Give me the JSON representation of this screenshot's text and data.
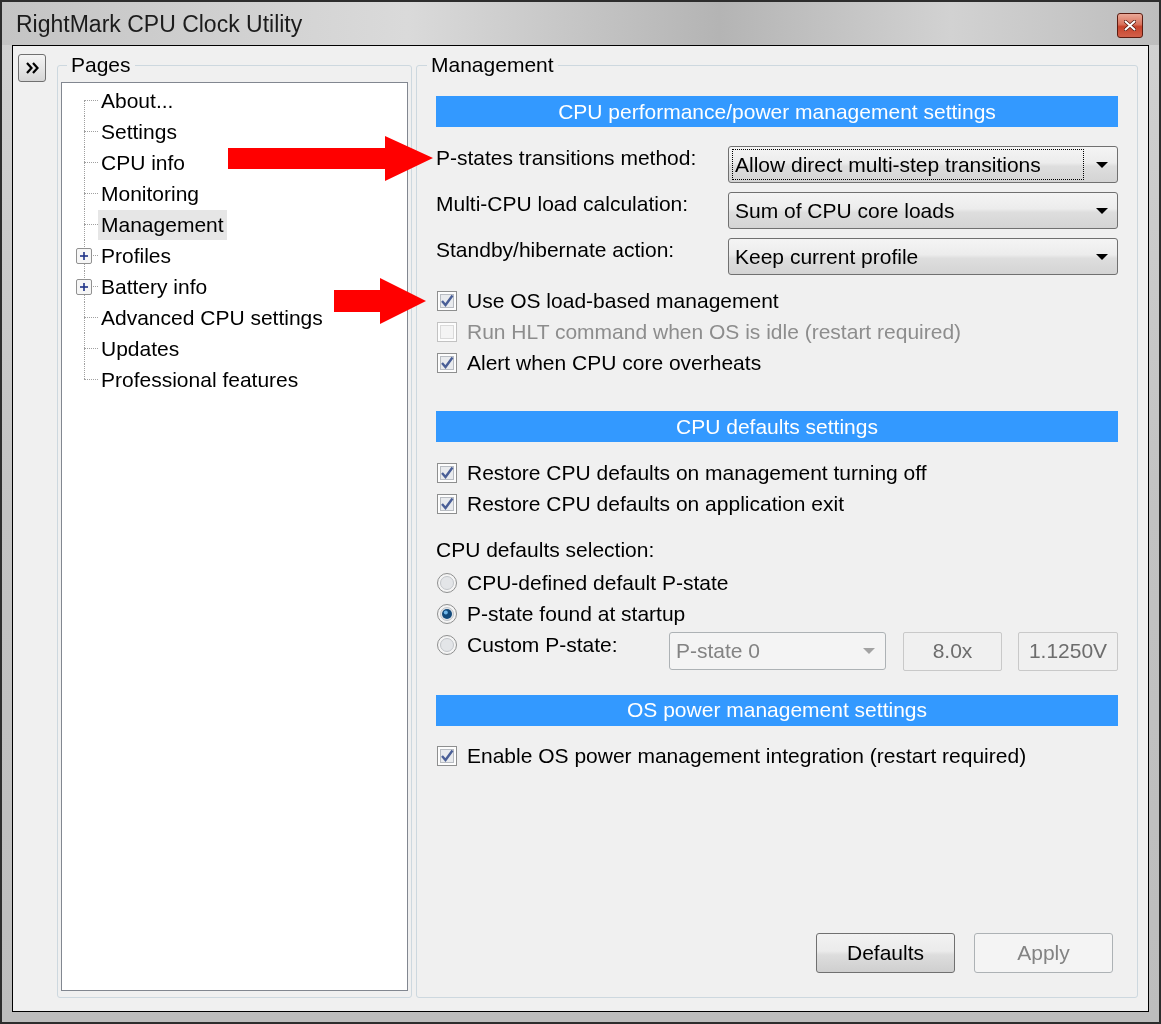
{
  "window": {
    "title": "RightMark CPU Clock Utility"
  },
  "pages": {
    "title": "Pages",
    "items": [
      {
        "label": "About...",
        "kind": "leaf",
        "selected": false
      },
      {
        "label": "Settings",
        "kind": "leaf",
        "selected": false
      },
      {
        "label": "CPU info",
        "kind": "leaf",
        "selected": false
      },
      {
        "label": "Monitoring",
        "kind": "leaf",
        "selected": false
      },
      {
        "label": "Management",
        "kind": "leaf",
        "selected": true
      },
      {
        "label": "Profiles",
        "kind": "group",
        "expanded": false,
        "selected": false
      },
      {
        "label": "Battery info",
        "kind": "group",
        "expanded": false,
        "selected": false
      },
      {
        "label": "Advanced CPU settings",
        "kind": "leaf",
        "selected": false
      },
      {
        "label": "Updates",
        "kind": "leaf",
        "selected": false
      },
      {
        "label": "Professional features",
        "kind": "leaf",
        "selected": false
      }
    ]
  },
  "management": {
    "title": "Management",
    "sections": [
      {
        "header": "CPU performance/power management settings",
        "controls": [
          {
            "kind": "dropdown",
            "label": "P-states transitions method:",
            "value": "Allow direct multi-step transitions",
            "focused": true
          },
          {
            "kind": "dropdown",
            "label": "Multi-CPU load calculation:",
            "value": "Sum of CPU core loads",
            "focused": false
          },
          {
            "kind": "dropdown",
            "label": "Standby/hibernate action:",
            "value": "Keep current profile",
            "focused": false
          },
          {
            "kind": "checkbox",
            "label": "Use OS load-based management",
            "checked": true,
            "disabled": false
          },
          {
            "kind": "checkbox",
            "label": "Run HLT command when OS is idle (restart required)",
            "checked": false,
            "disabled": true
          },
          {
            "kind": "checkbox",
            "label": "Alert when CPU core overheats",
            "checked": true,
            "disabled": false
          }
        ]
      },
      {
        "header": "CPU defaults settings",
        "controls": [
          {
            "kind": "checkbox",
            "label": "Restore CPU defaults on management turning off",
            "checked": true,
            "disabled": false
          },
          {
            "kind": "checkbox",
            "label": "Restore CPU defaults on application exit",
            "checked": true,
            "disabled": false
          },
          {
            "kind": "caption",
            "label": "CPU defaults selection:"
          },
          {
            "kind": "radio",
            "label": "CPU-defined default P-state",
            "selected": false
          },
          {
            "kind": "radio",
            "label": "P-state found at startup",
            "selected": true
          },
          {
            "kind": "radio",
            "label": "Custom P-state:",
            "selected": false,
            "pstate": {
              "value": "P-state 0",
              "disabled": true
            },
            "multiplier": {
              "value": "8.0x",
              "disabled": true
            },
            "voltage": {
              "value": "1.1250V",
              "disabled": true
            }
          }
        ]
      },
      {
        "header": "OS power management settings",
        "controls": [
          {
            "kind": "checkbox",
            "label": "Enable OS power management integration (restart required)",
            "checked": true,
            "disabled": false
          }
        ]
      }
    ],
    "buttons": [
      {
        "label": "Defaults",
        "disabled": false
      },
      {
        "label": "Apply",
        "disabled": true
      }
    ]
  }
}
